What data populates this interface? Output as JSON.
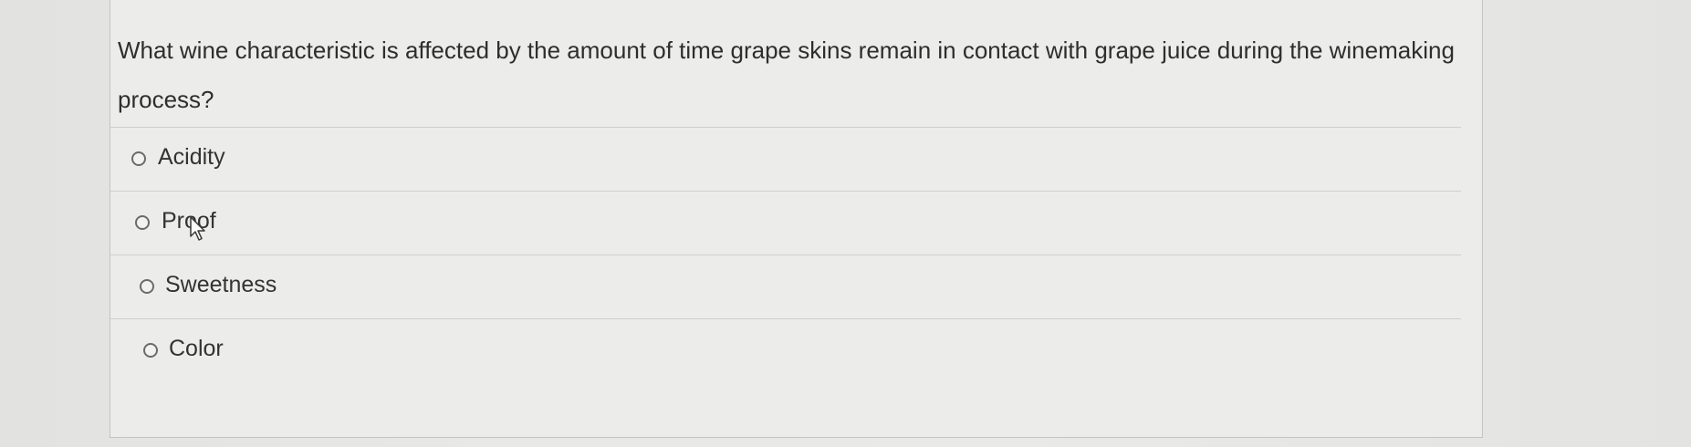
{
  "question": {
    "text": "What wine characteristic is affected by the amount of time grape skins remain in contact with grape juice during the winemaking process?"
  },
  "options": [
    {
      "label": "Acidity",
      "selected": false
    },
    {
      "label": "Proof",
      "selected": false
    },
    {
      "label": "Sweetness",
      "selected": false
    },
    {
      "label": "Color",
      "selected": false
    }
  ],
  "colors": {
    "text": "#2e2e2e",
    "radio_border": "#6b6b6b",
    "divider": "#cfcfcd"
  },
  "icons": {
    "cursor": "arrow-pointer-icon"
  }
}
